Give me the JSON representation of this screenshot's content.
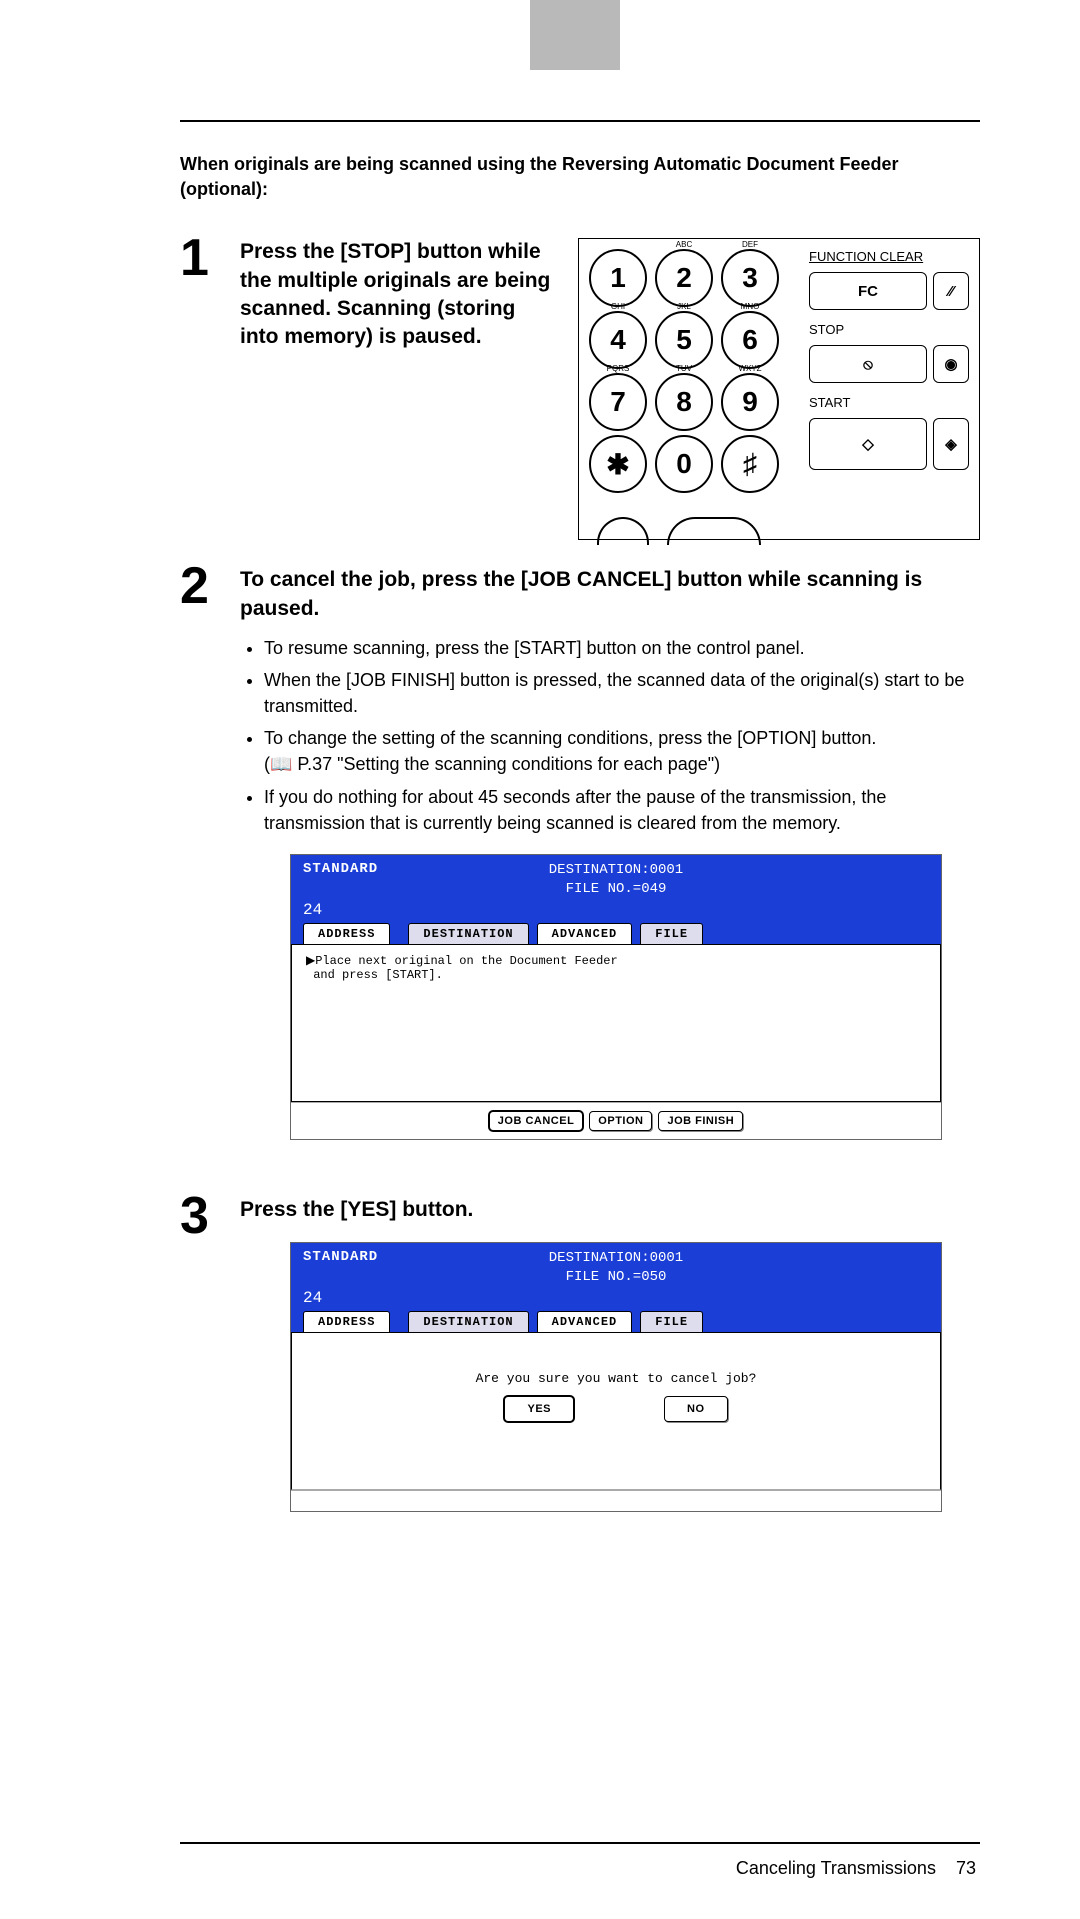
{
  "intro": "When originals are being scanned using the Reversing Automatic Document Feeder (optional):",
  "steps": {
    "s1": {
      "num": "1",
      "title": "Press the [STOP] button while the multiple originals are being scanned. Scanning (storing into memory) is paused."
    },
    "s2": {
      "num": "2",
      "title": "To cancel the job, press the [JOB CANCEL] button while scanning is paused.",
      "b1": "To resume scanning, press the [START] button on the control panel.",
      "b2": "When the [JOB FINISH] button is pressed, the scanned data of the original(s) start to be transmitted.",
      "b3": "To change the setting of the scanning conditions, press the [OPTION] button.",
      "b3ref": "(📖 P.37 \"Setting the scanning conditions for each page\")",
      "b4": "If you do nothing for about 45 seconds after the pause of the transmission, the transmission that is currently being scanned is cleared from the memory."
    },
    "s3": {
      "num": "3",
      "title": "Press the [YES] button."
    }
  },
  "keypad": {
    "k1": "1",
    "l1": "",
    "k2": "2",
    "l2": "ABC",
    "k3": "3",
    "l3": "DEF",
    "k4": "4",
    "l4": "GHI",
    "k5": "5",
    "l5": "JKL",
    "k6": "6",
    "l6": "MNO",
    "k7": "7",
    "l7": "PQRS",
    "k8": "8",
    "l8": "TUV",
    "k9": "9",
    "l9": "WXYZ",
    "kstar": "✱",
    "k0": "0",
    "khash": "♯",
    "functionclear": "FUNCTION CLEAR",
    "fc": "FC",
    "stop": "STOP",
    "start": "START"
  },
  "lcd1": {
    "standard": "STANDARD",
    "dest": "DESTINATION:0001",
    "file": "FILE NO.=049",
    "num": "24",
    "tab_address": "ADDRESS",
    "tab_destination": "DESTINATION",
    "tab_advanced": "ADVANCED",
    "tab_file": "FILE",
    "body": "▶Place next original on the Document Feeder\n and press [START].",
    "btn_jobcancel": "JOB CANCEL",
    "btn_option": "OPTION",
    "btn_jobfinish": "JOB FINISH"
  },
  "lcd2": {
    "standard": "STANDARD",
    "dest": "DESTINATION:0001",
    "file": "FILE NO.=050",
    "num": "24",
    "tab_address": "ADDRESS",
    "tab_destination": "DESTINATION",
    "tab_advanced": "ADVANCED",
    "tab_file": "FILE",
    "confirm": "Are you sure you want to cancel job?",
    "yes": "YES",
    "no": "NO"
  },
  "footer": {
    "title": "Canceling Transmissions",
    "page": "73"
  }
}
